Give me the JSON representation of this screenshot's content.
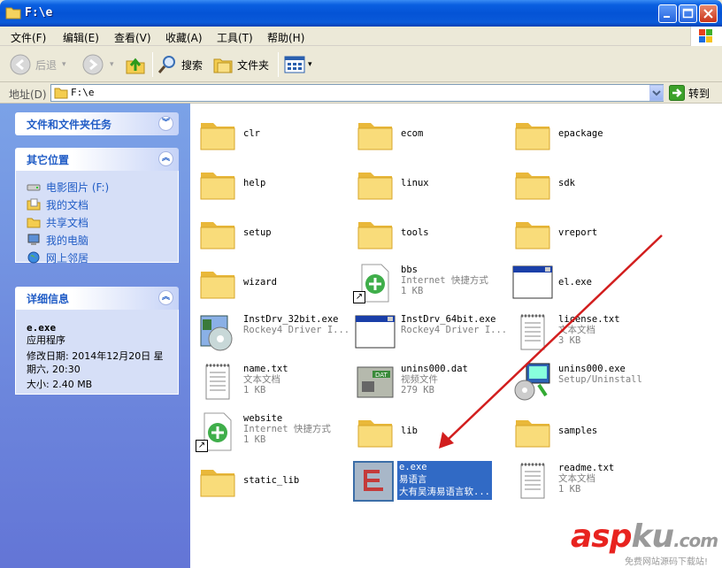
{
  "window": {
    "title": "F:\\e"
  },
  "menu": [
    {
      "label": "文件(F)"
    },
    {
      "label": "编辑(E)"
    },
    {
      "label": "查看(V)"
    },
    {
      "label": "收藏(A)"
    },
    {
      "label": "工具(T)"
    },
    {
      "label": "帮助(H)"
    }
  ],
  "toolbar": {
    "back_label": "后退",
    "search_label": "搜索",
    "folders_label": "文件夹"
  },
  "address": {
    "label": "地址(D)",
    "value": "F:\\e",
    "go_label": "转到"
  },
  "tasks_panel": {
    "title": "文件和文件夹任务"
  },
  "places_panel": {
    "title": "其它位置",
    "links": [
      {
        "label": "电影图片 (F:)",
        "icon": "drive-icon"
      },
      {
        "label": "我的文档",
        "icon": "my-documents-icon"
      },
      {
        "label": "共享文档",
        "icon": "shared-folder-icon"
      },
      {
        "label": "我的电脑",
        "icon": "my-computer-icon"
      },
      {
        "label": "网上邻居",
        "icon": "network-icon"
      }
    ]
  },
  "details_panel": {
    "title": "详细信息",
    "name": "e.exe",
    "type": "应用程序",
    "modified": "修改日期: 2014年12月20日 星期六, 20:30",
    "size": "大小: 2.40 MB"
  },
  "files": [
    {
      "name": "clr",
      "kind": "folder"
    },
    {
      "name": "ecom",
      "kind": "folder"
    },
    {
      "name": "epackage",
      "kind": "folder"
    },
    {
      "name": "help",
      "kind": "folder"
    },
    {
      "name": "linux",
      "kind": "folder"
    },
    {
      "name": "sdk",
      "kind": "folder"
    },
    {
      "name": "setup",
      "kind": "folder"
    },
    {
      "name": "tools",
      "kind": "folder"
    },
    {
      "name": "vreport",
      "kind": "folder"
    },
    {
      "name": "wizard",
      "kind": "folder"
    },
    {
      "name": "bbs",
      "line2": "Internet 快捷方式",
      "line3": "1 KB",
      "kind": "url"
    },
    {
      "name": "el.exe",
      "kind": "exe"
    },
    {
      "name": "InstDrv_32bit.exe",
      "line2": "Rockey4 Driver I...",
      "kind": "installer"
    },
    {
      "name": "InstDrv_64bit.exe",
      "line2": "Rockey4 Driver I...",
      "kind": "exe"
    },
    {
      "name": "license.txt",
      "line2": "文本文档",
      "line3": "3 KB",
      "kind": "txt"
    },
    {
      "name": "name.txt",
      "line2": "文本文档",
      "line3": "1 KB",
      "kind": "txt"
    },
    {
      "name": "unins000.dat",
      "line2": "视频文件",
      "line3": "279 KB",
      "kind": "dat"
    },
    {
      "name": "unins000.exe",
      "line2": "Setup/Uninstall",
      "kind": "uninstaller"
    },
    {
      "name": "website",
      "line2": "Internet 快捷方式",
      "line3": "1 KB",
      "kind": "url"
    },
    {
      "name": "lib",
      "kind": "folder"
    },
    {
      "name": "samples",
      "kind": "folder"
    },
    {
      "name": "static_lib",
      "kind": "folder"
    },
    {
      "name": "e.exe",
      "line2": "易语言",
      "line3": "大有吴涛易语言软...",
      "kind": "eapp",
      "selected": true
    },
    {
      "name": "readme.txt",
      "line2": "文本文档",
      "line3": "1 KB",
      "kind": "txt"
    }
  ],
  "watermark": {
    "logo": "aspku.com",
    "sub": "免费网站源码下载站!"
  },
  "colors": {
    "titlebar": "#0453d6",
    "sidebar_link": "#215dc6",
    "selection": "#316ac5",
    "annotation_arrow": "#d21e1e",
    "watermark_red": "#e8231f"
  }
}
